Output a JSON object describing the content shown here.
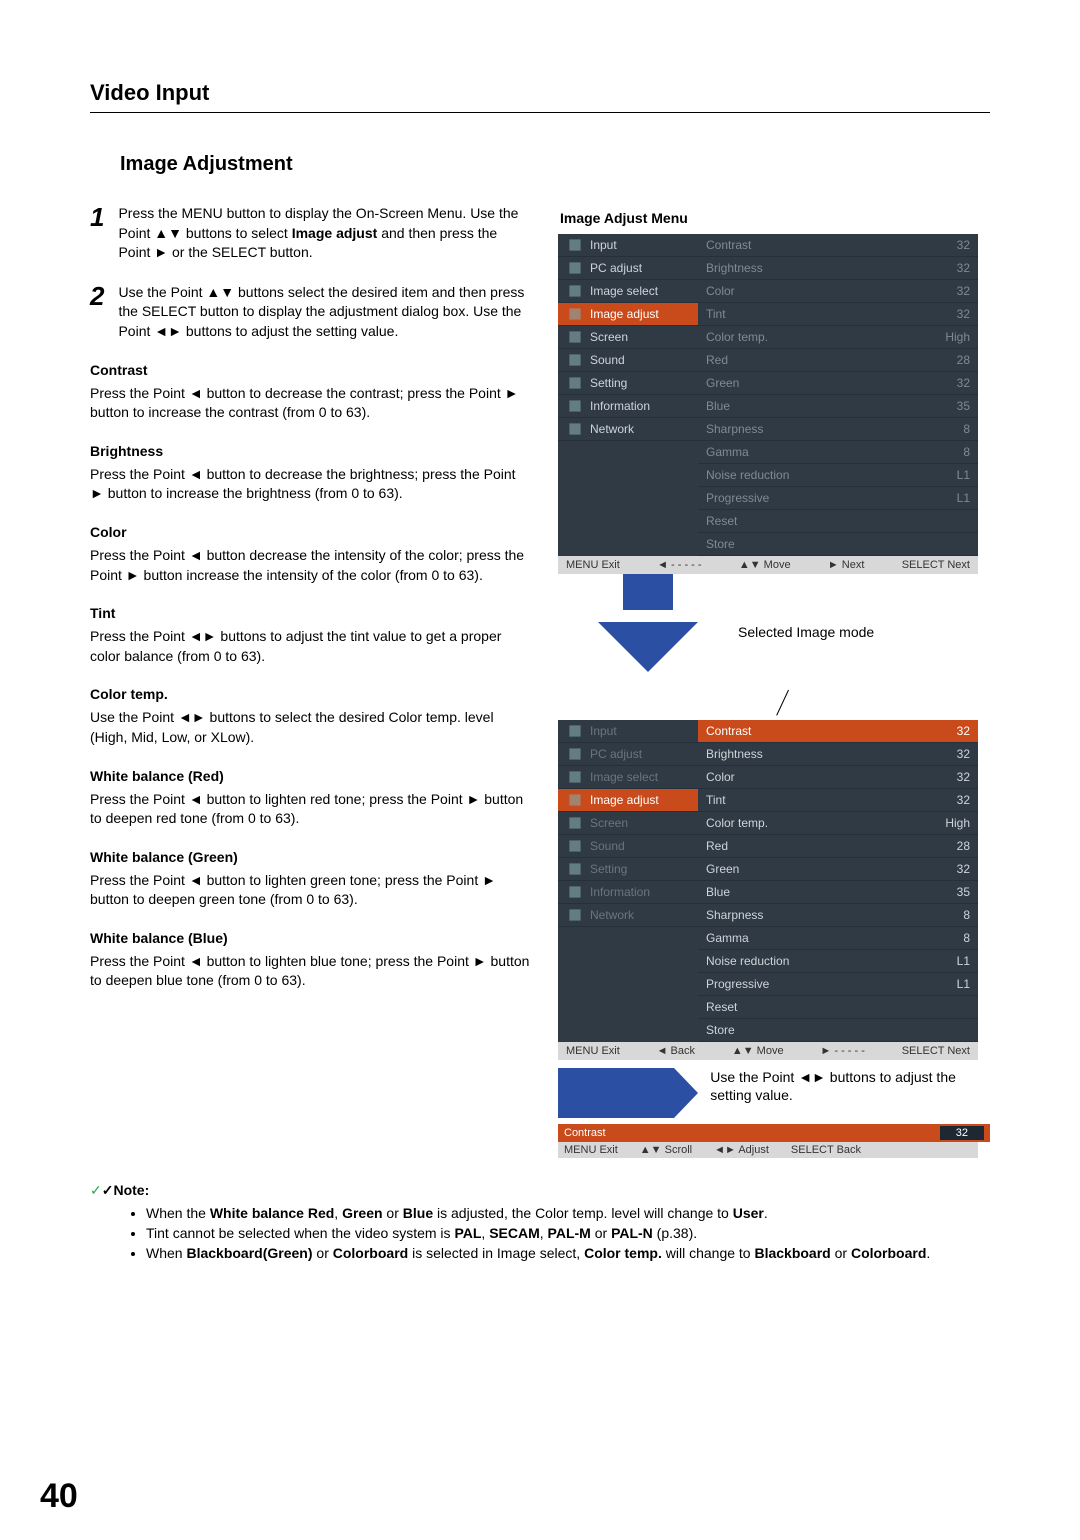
{
  "header": {
    "title": "Video Input"
  },
  "subheading": "Image Adjustment",
  "steps": [
    {
      "num": "1",
      "html": "Press the MENU button to display the On-Screen Menu. Use the Point ▲▼ buttons to select <b>Image adjust</b> and then press the Point ► or the SELECT button."
    },
    {
      "num": "2",
      "html": "Use the Point ▲▼ buttons select the desired item and then press the SELECT button to display the adjustment dialog box. Use the Point ◄► buttons to adjust the setting value."
    }
  ],
  "sections": [
    {
      "label": "Contrast",
      "text": "Press the Point ◄ button to decrease the contrast; press the Point ► button to increase the contrast (from 0 to 63)."
    },
    {
      "label": "Brightness",
      "text": "Press the Point ◄ button to decrease the brightness; press the Point ► button to increase the brightness (from 0 to 63)."
    },
    {
      "label": "Color",
      "text": "Press the Point ◄ button decrease the intensity of the color; press the Point ► button increase the intensity of the color (from 0 to 63)."
    },
    {
      "label": "Tint",
      "text": "Press the Point ◄► buttons to adjust the tint value to get a proper color balance (from 0 to 63)."
    },
    {
      "label": "Color temp.",
      "text": "Use the Point ◄► buttons to select the desired Color temp. level (High, Mid, Low, or XLow)."
    },
    {
      "label": "White balance (Red)",
      "text": "Press the Point ◄ button to lighten red tone; press the Point ► button to deepen red tone (from 0 to 63)."
    },
    {
      "label": "White balance (Green)",
      "text": "Press the Point ◄ button to lighten green tone; press the Point ► button to deepen green tone (from 0 to 63)."
    },
    {
      "label": "White balance (Blue)",
      "text": "Press the Point ◄ button to lighten blue tone; press the Point ► button to deepen blue tone (from 0 to 63)."
    }
  ],
  "note_label": "✓Note:",
  "notes": [
    "When the <b>White balance Red</b>, <b>Green</b> or <b>Blue</b> is adjusted, the Color temp. level will change to <b>User</b>.",
    "Tint cannot be selected when the video system is <b>PAL</b>, <b>SECAM</b>, <b>PAL-M</b> or <b>PAL-N</b> (p.38).",
    "When <b>Blackboard(Green)</b> or <b>Colorboard</b> is selected in Image select, <b>Color temp.</b> will change to <b>Blackboard</b> or <b>Colorboard</b>."
  ],
  "page_number": "40",
  "right": {
    "menu_title": "Image Adjust Menu",
    "selected_label": "Selected Image mode",
    "hint_text": "Use the Point ◄► buttons to adjust the setting value.",
    "left_menu": [
      "Input",
      "PC adjust",
      "Image select",
      "Image adjust",
      "Screen",
      "Sound",
      "Setting",
      "Information",
      "Network"
    ],
    "left_active_index": 3,
    "right_rows": [
      {
        "label": "Contrast",
        "val": "32"
      },
      {
        "label": "Brightness",
        "val": "32"
      },
      {
        "label": "Color",
        "val": "32"
      },
      {
        "label": "Tint",
        "val": "32"
      },
      {
        "label": "Color temp.",
        "val": "High"
      },
      {
        "label": "Red",
        "val": "28"
      },
      {
        "label": "Green",
        "val": "32"
      },
      {
        "label": "Blue",
        "val": "35"
      },
      {
        "label": "Sharpness",
        "val": "8"
      },
      {
        "label": "Gamma",
        "val": "8"
      },
      {
        "label": "Noise reduction",
        "val": "L1"
      },
      {
        "label": "Progressive",
        "val": "L1"
      },
      {
        "label": "Reset",
        "val": ""
      },
      {
        "label": "Store",
        "val": ""
      }
    ],
    "panel1_right_active_index": -1,
    "panel2_right_active_index": 0,
    "footer1": {
      "exit": "MENU Exit",
      "back": "◄ - - - - -",
      "move": "▲▼ Move",
      "next": "► Next",
      "select": "SELECT Next"
    },
    "footer2": {
      "exit": "MENU Exit",
      "back": "◄ Back",
      "move": "▲▼ Move",
      "next": "► - - - - -",
      "select": "SELECT Next"
    },
    "slider": {
      "label": "Contrast",
      "value": "32"
    },
    "slider_footer": {
      "exit": "MENU Exit",
      "scroll": "▲▼ Scroll",
      "adjust": "◄► Adjust",
      "back": "SELECT Back"
    }
  }
}
